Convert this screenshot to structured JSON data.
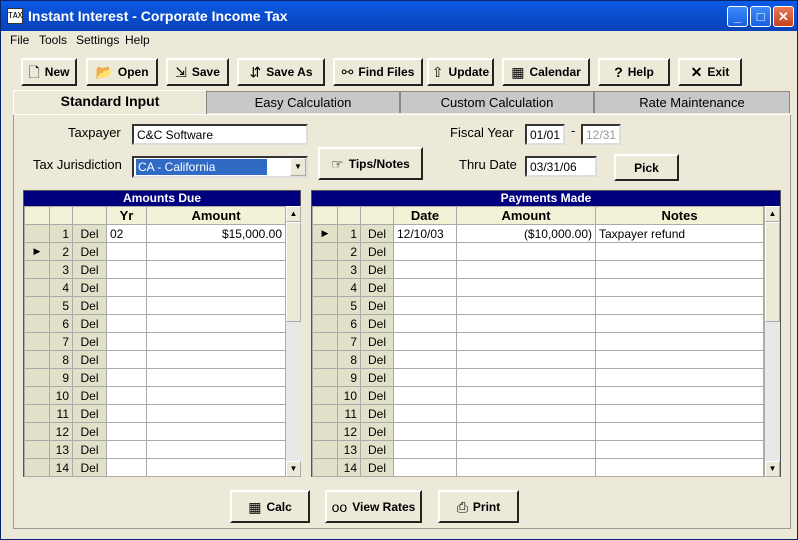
{
  "window": {
    "title": "Instant Interest - Corporate Income Tax",
    "app_icon": "TAX"
  },
  "menu": [
    "File",
    "Tools",
    "Settings",
    "Help"
  ],
  "toolbar": {
    "new": "New",
    "open": "Open",
    "save": "Save",
    "save_as": "Save As",
    "find_files": "Find Files",
    "update": "Update",
    "calendar": "Calendar",
    "help": "Help",
    "exit": "Exit"
  },
  "tabs": [
    "Standard Input",
    "Easy Calculation",
    "Custom Calculation",
    "Rate Maintenance"
  ],
  "form": {
    "taxpayer_label": "Taxpayer",
    "taxpayer_value": "C&C Software",
    "jurisdiction_label": "Tax Jurisdiction",
    "jurisdiction_value": "CA - California",
    "tips_button": "Tips/Notes",
    "fiscal_year_label": "Fiscal Year",
    "fiscal_year_start": "01/01",
    "fiscal_year_sep": "-",
    "fiscal_year_end": "12/31",
    "thru_date_label": "Thru Date",
    "thru_date_value": "03/31/06",
    "pick_button": "Pick"
  },
  "amounts_due": {
    "caption": "Amounts Due",
    "columns": [
      "Yr",
      "Amount"
    ],
    "rows": [
      {
        "n": "1",
        "del": "Del",
        "yr": "02",
        "amount": "$15,000.00"
      },
      {
        "n": "2",
        "del": "Del",
        "yr": "",
        "amount": ""
      },
      {
        "n": "3",
        "del": "Del",
        "yr": "",
        "amount": ""
      },
      {
        "n": "4",
        "del": "Del",
        "yr": "",
        "amount": ""
      },
      {
        "n": "5",
        "del": "Del",
        "yr": "",
        "amount": ""
      },
      {
        "n": "6",
        "del": "Del",
        "yr": "",
        "amount": ""
      },
      {
        "n": "7",
        "del": "Del",
        "yr": "",
        "amount": ""
      },
      {
        "n": "8",
        "del": "Del",
        "yr": "",
        "amount": ""
      },
      {
        "n": "9",
        "del": "Del",
        "yr": "",
        "amount": ""
      },
      {
        "n": "10",
        "del": "Del",
        "yr": "",
        "amount": ""
      },
      {
        "n": "11",
        "del": "Del",
        "yr": "",
        "amount": ""
      },
      {
        "n": "12",
        "del": "Del",
        "yr": "",
        "amount": ""
      },
      {
        "n": "13",
        "del": "Del",
        "yr": "",
        "amount": ""
      },
      {
        "n": "14",
        "del": "Del",
        "yr": "",
        "amount": ""
      }
    ]
  },
  "payments_made": {
    "caption": "Payments Made",
    "columns": [
      "Date",
      "Amount",
      "Notes"
    ],
    "rows": [
      {
        "n": "1",
        "del": "Del",
        "date": "12/10/03",
        "amount": "($10,000.00)",
        "notes": "Taxpayer refund"
      },
      {
        "n": "2",
        "del": "Del",
        "date": "",
        "amount": "",
        "notes": ""
      },
      {
        "n": "3",
        "del": "Del",
        "date": "",
        "amount": "",
        "notes": ""
      },
      {
        "n": "4",
        "del": "Del",
        "date": "",
        "amount": "",
        "notes": ""
      },
      {
        "n": "5",
        "del": "Del",
        "date": "",
        "amount": "",
        "notes": ""
      },
      {
        "n": "6",
        "del": "Del",
        "date": "",
        "amount": "",
        "notes": ""
      },
      {
        "n": "7",
        "del": "Del",
        "date": "",
        "amount": "",
        "notes": ""
      },
      {
        "n": "8",
        "del": "Del",
        "date": "",
        "amount": "",
        "notes": ""
      },
      {
        "n": "9",
        "del": "Del",
        "date": "",
        "amount": "",
        "notes": ""
      },
      {
        "n": "10",
        "del": "Del",
        "date": "",
        "amount": "",
        "notes": ""
      },
      {
        "n": "11",
        "del": "Del",
        "date": "",
        "amount": "",
        "notes": ""
      },
      {
        "n": "12",
        "del": "Del",
        "date": "",
        "amount": "",
        "notes": ""
      },
      {
        "n": "13",
        "del": "Del",
        "date": "",
        "amount": "",
        "notes": ""
      },
      {
        "n": "14",
        "del": "Del",
        "date": "",
        "amount": "",
        "notes": ""
      }
    ]
  },
  "bottom": {
    "calc": "Calc",
    "view_rates": "View Rates",
    "print": "Print"
  },
  "colors": {
    "titlebar": "#0b4fd1",
    "grid_caption": "#00007f",
    "selection": "#316ac5"
  }
}
